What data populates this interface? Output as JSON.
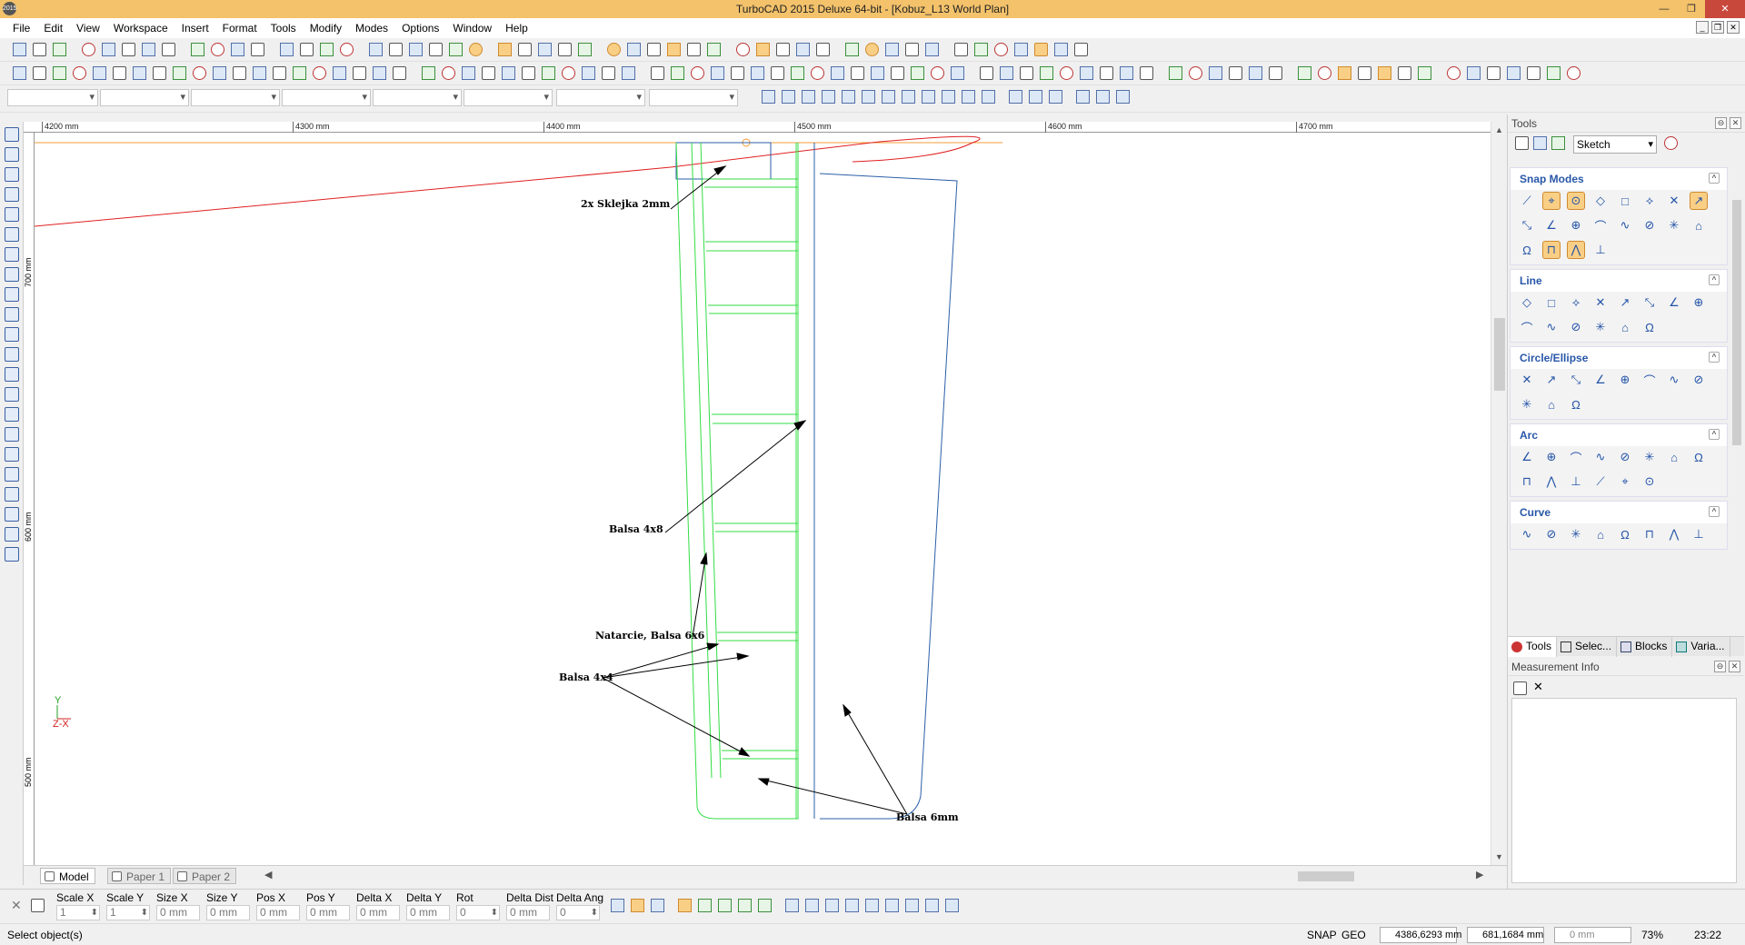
{
  "window": {
    "title": "TurboCAD 2015 Deluxe 64-bit - [Kobuz_L13 World Plan]",
    "app_badge": "2015"
  },
  "menu": [
    "File",
    "Edit",
    "View",
    "Workspace",
    "Insert",
    "Format",
    "Tools",
    "Modify",
    "Modes",
    "Options",
    "Window",
    "Help"
  ],
  "rulers": {
    "horizontal": [
      "4200 mm",
      "4300 mm",
      "4400 mm",
      "4500 mm",
      "4600 mm",
      "4700 mm"
    ],
    "vertical": [
      "700 mm",
      "600 mm",
      "500 mm"
    ]
  },
  "drawing": {
    "annotations": [
      {
        "text": "2x Sklejka 2mm"
      },
      {
        "text": "Balsa 4x8"
      },
      {
        "text": "Natarcie, Balsa 6x6"
      },
      {
        "text": "Balsa 4x4"
      },
      {
        "text": "Balsa 6mm"
      }
    ],
    "colors": {
      "rib": "#33dd44",
      "outline": "#2b5fa8",
      "wing": "#e02020",
      "datum": "#f39c3a",
      "leader": "#000000"
    },
    "axis_y": "Y",
    "axis_x": "Z-X"
  },
  "sheet_tabs": [
    {
      "label": "Model",
      "active": true
    },
    {
      "label": "Paper 1",
      "active": false
    },
    {
      "label": "Paper 2",
      "active": false
    }
  ],
  "panel": {
    "title": "Tools",
    "mode_value": "Sketch",
    "groups": [
      {
        "title": "Snap Modes",
        "count": 20
      },
      {
        "title": "Line",
        "count": 14
      },
      {
        "title": "Circle/Ellipse",
        "count": 11
      },
      {
        "title": "Arc",
        "count": 14
      },
      {
        "title": "Curve",
        "count": 8
      }
    ],
    "tabs": [
      "Tools",
      "Selec...",
      "Blocks",
      "Varia..."
    ],
    "measurement_title": "Measurement Info"
  },
  "inspector": {
    "fields": [
      {
        "label": "Scale X",
        "value": "1"
      },
      {
        "label": "Scale Y",
        "value": "1"
      },
      {
        "label": "Size X",
        "value": "0 mm"
      },
      {
        "label": "Size Y",
        "value": "0 mm"
      },
      {
        "label": "Pos X",
        "value": "0 mm"
      },
      {
        "label": "Pos Y",
        "value": "0 mm"
      },
      {
        "label": "Delta X",
        "value": "0 mm"
      },
      {
        "label": "Delta Y",
        "value": "0 mm"
      },
      {
        "label": "Rot",
        "value": "0"
      },
      {
        "label": "Delta Dist",
        "value": "0 mm"
      },
      {
        "label": "Delta Ang",
        "value": "0"
      }
    ]
  },
  "status": {
    "message": "Select object(s)",
    "snap": "SNAP",
    "geo": "GEO",
    "coord_x": "4386,6293 mm",
    "coord_y": "681,1684 mm",
    "coord_z": "0 mm",
    "zoom": "73%",
    "time": "23:22"
  }
}
